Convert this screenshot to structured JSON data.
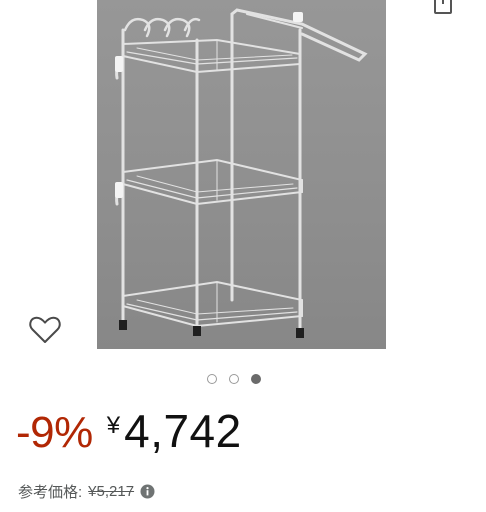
{
  "product": {
    "image_alt": "corner shelf rack",
    "carousel": {
      "total": 3,
      "active_index": 2
    }
  },
  "pricing": {
    "discount": "-9%",
    "currency_symbol": "¥",
    "price": "4,742",
    "list_price_label": "参考価格:",
    "list_price": "¥5,217"
  },
  "icons": {
    "wishlist": "heart-icon",
    "share": "share-icon",
    "info": "info-icon"
  },
  "colors": {
    "discount": "#b12704",
    "price": "#111111",
    "list_price": "#565959",
    "image_background": "#8f8f8f",
    "dot_active": "#6b6b6b",
    "dot_inactive_border": "#9a9a9a"
  }
}
